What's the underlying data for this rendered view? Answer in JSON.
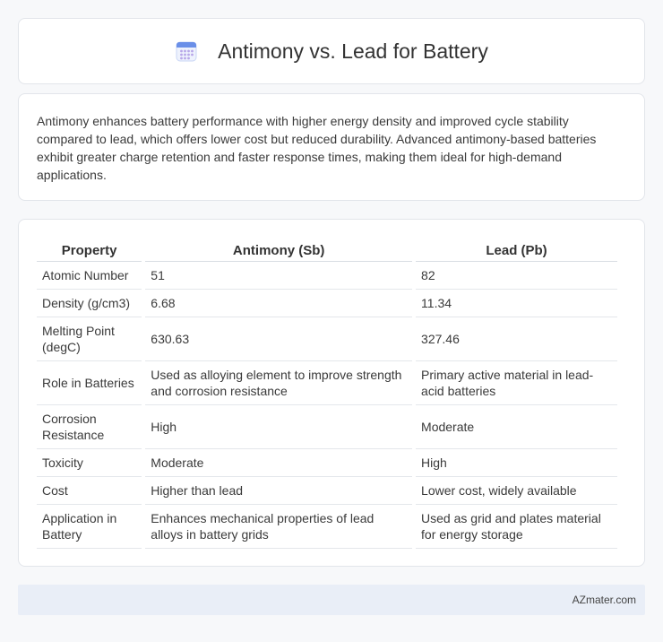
{
  "header": {
    "title": "Antimony vs. Lead for Battery",
    "icon": "calendar-icon",
    "icon_color": "#6a8fe8"
  },
  "summary": {
    "text": "Antimony enhances battery performance with higher energy density and improved cycle stability compared to lead, which offers lower cost but reduced durability. Advanced antimony-based batteries exhibit greater charge retention and faster response times, making them ideal for high-demand applications."
  },
  "table": {
    "headers": [
      "Property",
      "Antimony (Sb)",
      "Lead (Pb)"
    ],
    "rows": [
      [
        "Atomic Number",
        "51",
        "82"
      ],
      [
        "Density (g/cm3)",
        "6.68",
        "11.34"
      ],
      [
        "Melting Point (degC)",
        "630.63",
        "327.46"
      ],
      [
        "Role in Batteries",
        "Used as alloying element to improve strength and corrosion resistance",
        "Primary active material in lead-acid batteries"
      ],
      [
        "Corrosion Resistance",
        "High",
        "Moderate"
      ],
      [
        "Toxicity",
        "Moderate",
        "High"
      ],
      [
        "Cost",
        "Higher than lead",
        "Lower cost, widely available"
      ],
      [
        "Application in Battery",
        "Enhances mechanical properties of lead alloys in battery grids",
        "Used as grid and plates material for energy storage"
      ]
    ]
  },
  "footer": {
    "text": "AZmater.com"
  }
}
